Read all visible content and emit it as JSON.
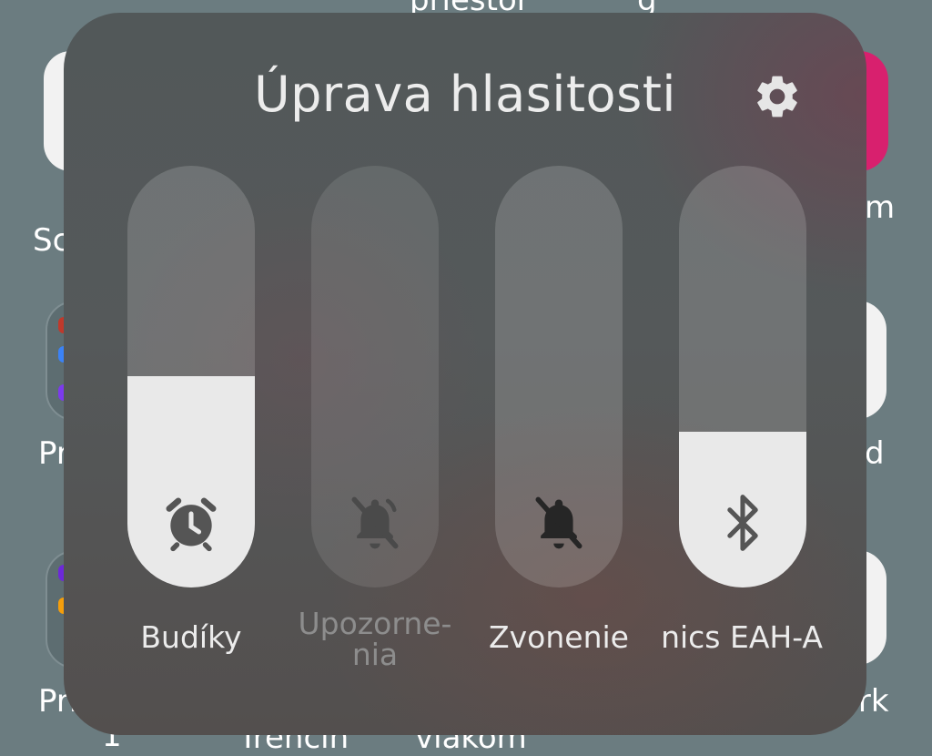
{
  "background": {
    "labels": {
      "top_cut_1": "priestor",
      "top_cut_2": "g",
      "left_row1": "Sc",
      "left_row2": "Pr",
      "left_row3": "Pri",
      "left_row3_sub": "1",
      "right_row1": "m",
      "right_row2": "d",
      "right_row3": "ark",
      "bottom_cut_1": "Trenčín",
      "bottom_cut_2": "vlakom"
    },
    "accent_pink": "#d8206e"
  },
  "panel": {
    "title": "Úprava hlasitosti",
    "settings_icon": "gear-icon",
    "sliders": [
      {
        "id": "alarms",
        "label": "Budíky",
        "label2": "",
        "icon": "alarm-clock-icon",
        "level": 0.5,
        "enabled": true
      },
      {
        "id": "notifications",
        "label": "Upozorne-",
        "label2": "nia",
        "icon": "bell-off-icon",
        "level": 0.0,
        "enabled": false
      },
      {
        "id": "ringtone",
        "label": "Zvonenie",
        "label2": "",
        "icon": "bell-off-icon",
        "level": 0.0,
        "enabled": true
      },
      {
        "id": "bluetooth",
        "label": "Technics EAH-A",
        "label2": "",
        "icon": "bluetooth-icon",
        "level": 0.37,
        "enabled": true
      }
    ]
  }
}
